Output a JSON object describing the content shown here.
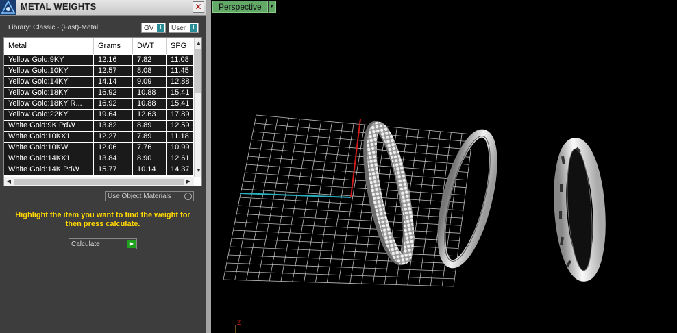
{
  "panel": {
    "title": "METAL WEIGHTS",
    "close_glyph": "✕",
    "library_label": "Library: Classic - (Fast)-Metal",
    "gv_label": "GV",
    "user_label": "User",
    "columns": [
      "Metal",
      "Grams",
      "DWT",
      "SPG"
    ],
    "rows": [
      [
        "Yellow Gold:9KY",
        "12.16",
        "7.82",
        "11.08"
      ],
      [
        "Yellow Gold:10KY",
        "12.57",
        "8.08",
        "11.45"
      ],
      [
        "Yellow Gold:14KY",
        "14.14",
        "9.09",
        "12.88"
      ],
      [
        "Yellow Gold:18KY",
        "16.92",
        "10.88",
        "15.41"
      ],
      [
        "Yellow Gold:18KY R...",
        "16.92",
        "10.88",
        "15.41"
      ],
      [
        "Yellow Gold:22KY",
        "19.64",
        "12.63",
        "17.89"
      ],
      [
        "White Gold:9K PdW",
        "13.82",
        "8.89",
        "12.59"
      ],
      [
        "White Gold:10KX1",
        "12.27",
        "7.89",
        "11.18"
      ],
      [
        "White Gold:10KW",
        "12.06",
        "7.76",
        "10.99"
      ],
      [
        "White Gold:14KX1",
        "13.84",
        "8.90",
        "12.61"
      ],
      [
        "White Gold:14K PdW",
        "15.77",
        "10.14",
        "14.37"
      ]
    ],
    "use_object_materials": "Use Object Materials",
    "hint": "Highlight the item you want to find the weight for then press calculate.",
    "calculate_label": "Calculate"
  },
  "viewport": {
    "view_name": "Perspective",
    "axis_label": "Z"
  },
  "colors": {
    "hint_text": "#ffd700",
    "view_tab": "#62a867",
    "x_axis": "#2ab0c0",
    "y_axis": "#d01a1a",
    "go_button": "#1fa01f"
  }
}
